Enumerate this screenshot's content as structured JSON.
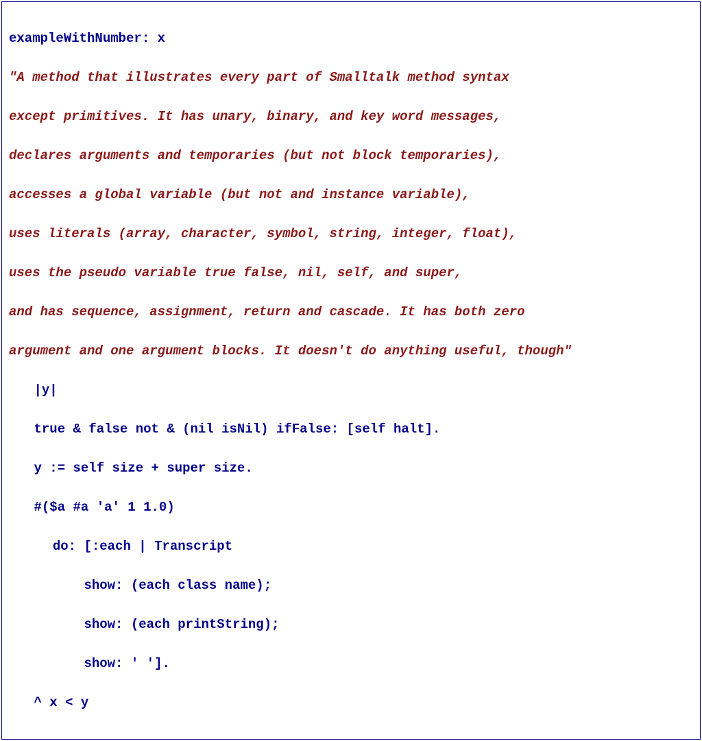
{
  "signature": "exampleWithNumber: x",
  "comment": [
    "\"A method that illustrates every part of Smalltalk method syntax",
    "except primitives. It has unary, binary, and key word messages,",
    "declares arguments and temporaries (but not block temporaries),",
    "accesses a global variable (but not and instance variable),",
    "uses literals (array, character, symbol, string, integer, float),",
    "uses the pseudo variable true false, nil, self, and super,",
    "and has sequence, assignment, return and cascade. It has both zero",
    "argument and one argument blocks. It doesn't do anything useful, though\""
  ],
  "code": {
    "l1": "|y|",
    "l2": "true & false not & (nil isNil) ifFalse: [self halt].",
    "l3": "y := self size + super size.",
    "l4": "#($a #a 'a' 1 1.0)",
    "l5": "do: [:each | Transcript",
    "l6": "show: (each class name);",
    "l7": "show: (each printString);",
    "l8": "show: ' '].",
    "l9": "^ x < y"
  }
}
